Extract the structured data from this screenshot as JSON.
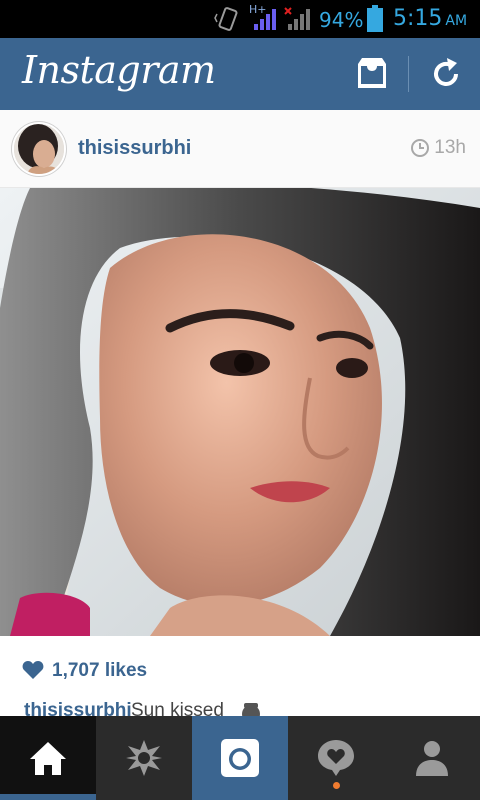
{
  "status_bar": {
    "network_label": "H+",
    "battery_percent": "94%",
    "time": "5:15",
    "ampm": "AM",
    "icons": [
      "vibrate-icon",
      "signal-icon",
      "no-signal-icon",
      "battery-icon"
    ]
  },
  "header": {
    "title": "Instagram",
    "icons": [
      "inbox-icon",
      "refresh-icon"
    ]
  },
  "post": {
    "username": "thisissurbhi",
    "time_ago": "13h",
    "likes": "1,707 likes",
    "caption": {
      "username": "thisissurbhi",
      "text": "Sun kissed"
    }
  },
  "bottom_nav": {
    "items": [
      "home-icon",
      "explore-icon",
      "camera-icon",
      "activity-icon",
      "profile-icon"
    ],
    "active": "home"
  },
  "colors": {
    "brand": "#3b6590",
    "status_text": "#35a8e0",
    "nav_bg": "#2b2b2b",
    "notification": "#f07c30"
  }
}
